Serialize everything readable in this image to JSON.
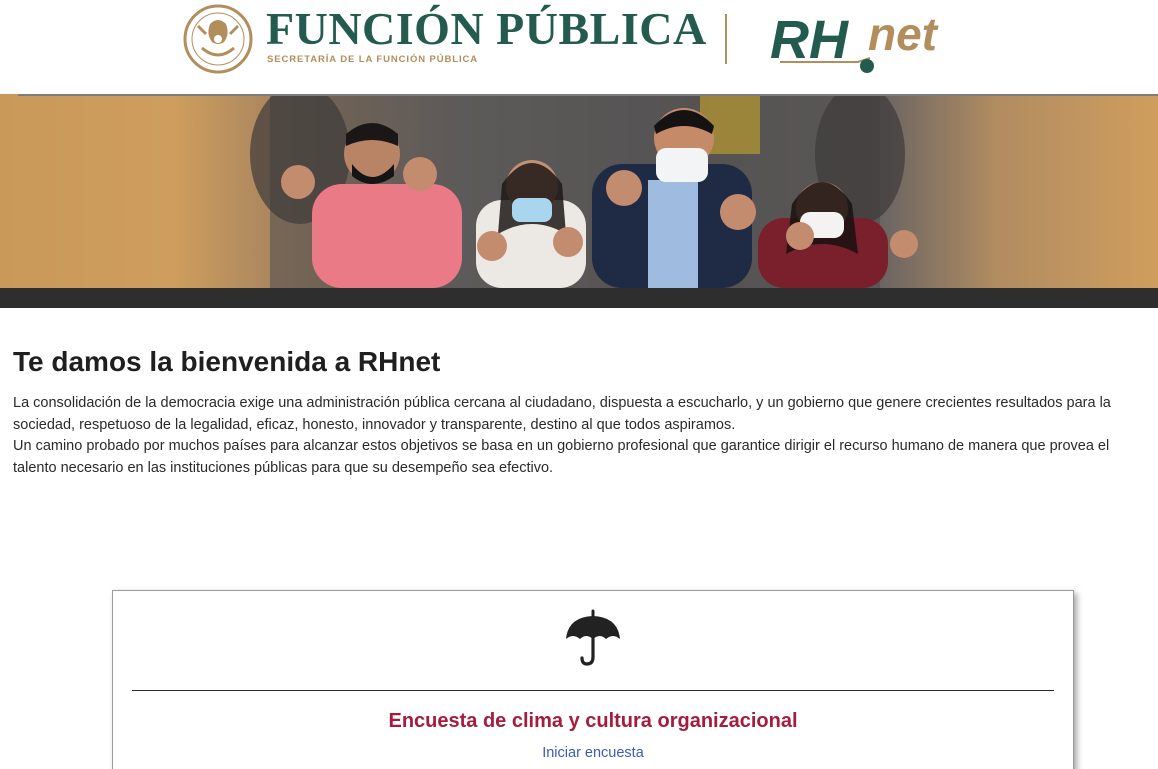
{
  "header": {
    "brand_title": "FUNCIÓN PÚBLICA",
    "brand_subtitle": "SECRETARÍA DE LA FUNCIÓN PÚBLICA",
    "seal_icon": "mexico-coat-of-arms-seal",
    "rhnet_logo_text": "RHnet"
  },
  "banner": {
    "image": "group-of-people-with-masks-thumbs-up-photo"
  },
  "welcome": {
    "title": "Te damos la bienvenida a RHnet",
    "paragraph_1": "La consolidación de la democracia exige una administración pública cercana al ciudadano, dispuesta a escucharlo, y un gobierno que genere crecientes resultados para la sociedad, respetuoso de la legalidad, eficaz, honesto, innovador y transparente, destino al que todos aspiramos.",
    "paragraph_2": "Un camino probado por muchos países para alcanzar estos objetivos se basa en un gobierno profesional que garantice dirigir el recurso humano de manera que provea el talento necesario en las instituciones públicas para que su desempeño sea efectivo."
  },
  "survey_card": {
    "icon": "umbrella-icon",
    "title": "Encuesta de clima y cultura organizacional",
    "link_label": "Iniciar encuesta"
  },
  "colors": {
    "brand_green": "#235b4e",
    "brand_gold": "#b38e5d",
    "card_title": "#a51c3e",
    "link": "#3a5bbf",
    "banner_bar": "#2e2e2e"
  }
}
